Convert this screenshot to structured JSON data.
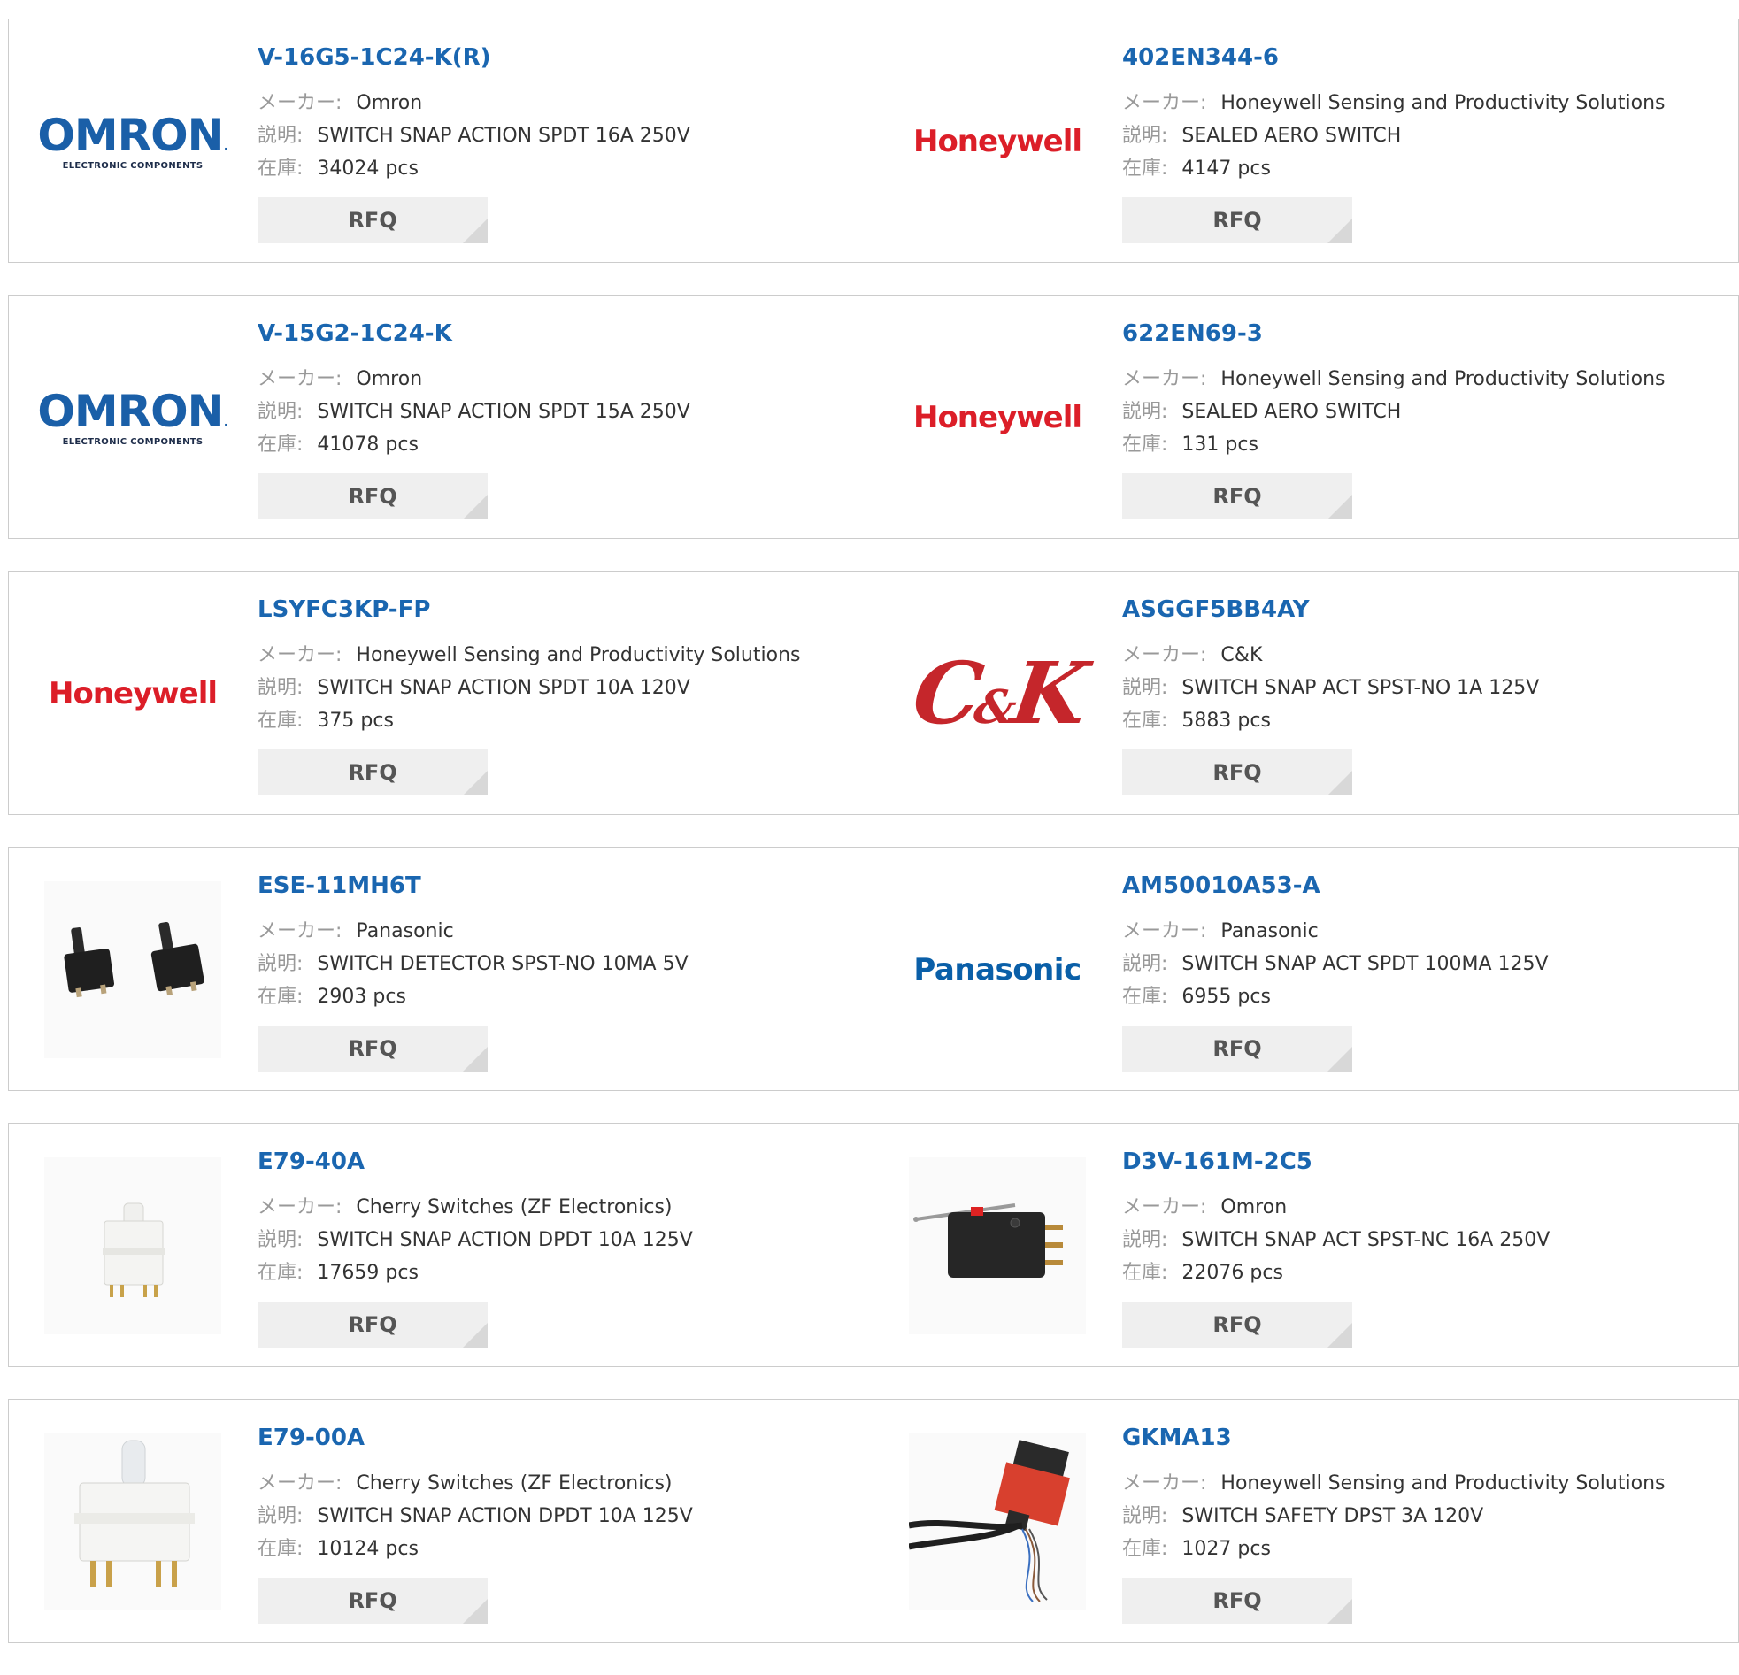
{
  "labels": {
    "maker": "メーカー:",
    "description": "説明:",
    "stock": "在庫:",
    "rfq": "RFQ"
  },
  "colors": {
    "link": "#1a66b0",
    "honeywell": "#dc1e28",
    "omron": "#1a5fa8",
    "panasonic": "#0a5fa8",
    "ck": "#c5262b"
  },
  "products": [
    {
      "part": "V-16G5-1C24-K(R)",
      "maker": "Omron",
      "description": "SWITCH SNAP ACTION SPDT 16A 250V",
      "stock": "34024 pcs",
      "logo": "omron"
    },
    {
      "part": "402EN344-6",
      "maker": "Honeywell Sensing and Productivity Solutions",
      "description": "SEALED AERO SWITCH",
      "stock": "4147 pcs",
      "logo": "honeywell"
    },
    {
      "part": "V-15G2-1C24-K",
      "maker": "Omron",
      "description": "SWITCH SNAP ACTION SPDT 15A 250V",
      "stock": "41078 pcs",
      "logo": "omron"
    },
    {
      "part": "622EN69-3",
      "maker": "Honeywell Sensing and Productivity Solutions",
      "description": "SEALED AERO SWITCH",
      "stock": "131 pcs",
      "logo": "honeywell"
    },
    {
      "part": "LSYFC3KP-FP",
      "maker": "Honeywell Sensing and Productivity Solutions",
      "description": "SWITCH SNAP ACTION SPDT 10A 120V",
      "stock": "375 pcs",
      "logo": "honeywell"
    },
    {
      "part": "ASGGF5BB4AY",
      "maker": "C&K",
      "description": "SWITCH SNAP ACT SPST-NO 1A 125V",
      "stock": "5883 pcs",
      "logo": "ck"
    },
    {
      "part": "ESE-11MH6T",
      "maker": "Panasonic",
      "description": "SWITCH DETECTOR SPST-NO 10MA 5V",
      "stock": "2903 pcs",
      "logo": "photo-detector-switches"
    },
    {
      "part": "AM50010A53-A",
      "maker": "Panasonic",
      "description": "SWITCH SNAP ACT SPDT 100MA 125V",
      "stock": "6955 pcs",
      "logo": "panasonic"
    },
    {
      "part": "E79-40A",
      "maker": "Cherry Switches (ZF Electronics)",
      "description": "SWITCH SNAP ACTION DPDT 10A 125V",
      "stock": "17659 pcs",
      "logo": "photo-white-plunger-switch"
    },
    {
      "part": "D3V-161M-2C5",
      "maker": "Omron",
      "description": "SWITCH SNAP ACT SPST-NC 16A 250V",
      "stock": "22076 pcs",
      "logo": "photo-lever-microswitch"
    },
    {
      "part": "E79-00A",
      "maker": "Cherry Switches (ZF Electronics)",
      "description": "SWITCH SNAP ACTION DPDT 10A 125V",
      "stock": "10124 pcs",
      "logo": "photo-white-plunger-switch-large"
    },
    {
      "part": "GKMA13",
      "maker": "Honeywell Sensing and Productivity Solutions",
      "description": "SWITCH SAFETY DPST 3A 120V",
      "stock": "1027 pcs",
      "logo": "photo-safety-switch-cable"
    }
  ],
  "logo_text": {
    "omron_word": "OMRON",
    "omron_dot": ".",
    "omron_sub": "ELECTRONIC COMPONENTS",
    "honeywell": "Honeywell",
    "panasonic": "Panasonic",
    "ck_c": "C",
    "ck_amp": "&",
    "ck_k": "K"
  }
}
